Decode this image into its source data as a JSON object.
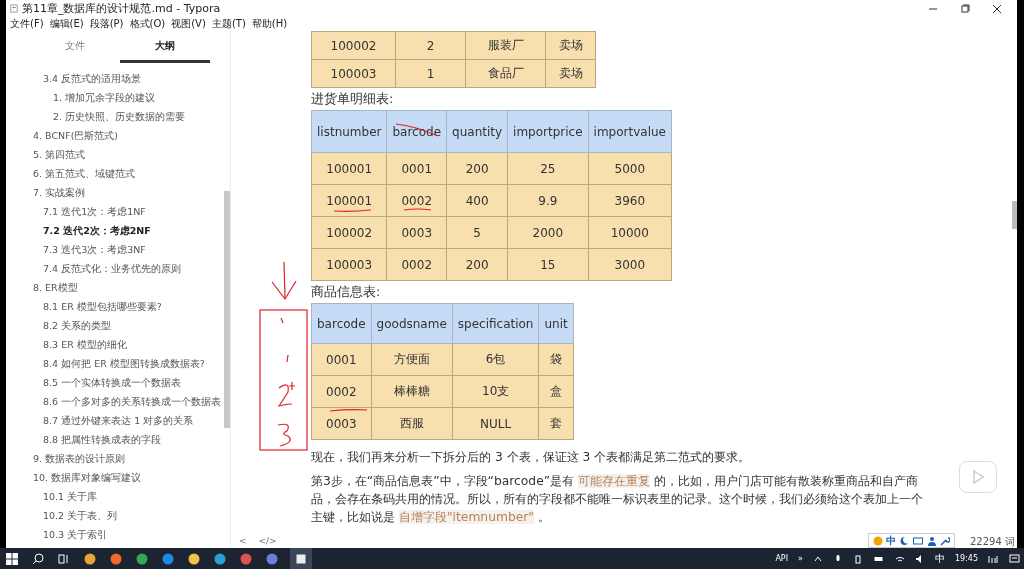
{
  "window": {
    "title": "第11章_数据库的设计规范.md - Typora"
  },
  "menu": [
    "文件(F)",
    "编辑(E)",
    "段落(P)",
    "格式(O)",
    "视图(V)",
    "主题(T)",
    "帮助(H)"
  ],
  "sidebar": {
    "tabs": [
      {
        "label": "文件",
        "selected": false
      },
      {
        "label": "大纲",
        "selected": true
      }
    ],
    "outline": [
      {
        "children": [
          {
            "label": "3.4 反范式的适用场景",
            "selected": false,
            "children": [
              {
                "label": "1. 增加冗余字段的建议",
                "selected": false
              },
              {
                "label": "2. 历史快照、历史数据的需要",
                "selected": false
              }
            ]
          }
        ]
      },
      {
        "label": "4. BCNF(巴斯范式)",
        "selected": false
      },
      {
        "label": "5. 第四范式",
        "selected": false
      },
      {
        "label": "6. 第五范式、域键范式",
        "selected": false
      },
      {
        "label": "7. 实战案例",
        "selected": false,
        "children": [
          {
            "label": "7.1 迭代1次：考虑1NF",
            "selected": false
          },
          {
            "label": "7.2 迭代2次：考虑2NF",
            "selected": true
          },
          {
            "label": "7.3 迭代3次：考虑3NF",
            "selected": false
          },
          {
            "label": "7.4 反范式化：业务优先的原则",
            "selected": false
          }
        ]
      },
      {
        "label": "8. ER模型",
        "selected": false,
        "children": [
          {
            "label": "8.1 ER 模型包括哪些要素?",
            "selected": false
          },
          {
            "label": "8.2 关系的类型",
            "selected": false
          },
          {
            "label": "8.3 ER 模型的细化",
            "selected": false
          },
          {
            "label": "8.4 如何把 ER 模型图转换成数据表?",
            "selected": false
          },
          {
            "label": "8.5 一个实体转换成一个数据表",
            "selected": false
          },
          {
            "label": "8.6 一个多对多的关系转换成一个数据表",
            "selected": false
          },
          {
            "label": "8.7 通过外键来表达 1 对多的关系",
            "selected": false
          },
          {
            "label": "8.8 把属性转换成表的字段",
            "selected": false
          }
        ]
      },
      {
        "label": "9. 数据表的设计原则",
        "selected": false
      },
      {
        "label": "10. 数据库对象编写建议",
        "selected": false,
        "children": [
          {
            "label": "10.1 关于库",
            "selected": false
          },
          {
            "label": "10.2 关于表、列",
            "selected": false
          },
          {
            "label": "10.3 关于索引",
            "selected": false
          }
        ]
      }
    ]
  },
  "document": [
    {
      "kind": "table",
      "rows": [
        [
          "100002",
          "2",
          "服装厂",
          "卖场"
        ],
        [
          "100003",
          "1",
          "食品厂",
          "卖场"
        ]
      ]
    },
    {
      "kind": "caption",
      "text": "进货单明细表:"
    },
    {
      "kind": "table",
      "columns": [
        "listnumber",
        "barcode",
        "quantity",
        "importprice",
        "importvalue"
      ],
      "rows": [
        [
          "100001",
          "0001",
          "200",
          "25",
          "5000"
        ],
        [
          "100001",
          "0002",
          "400",
          "9.9",
          "3960"
        ],
        [
          "100002",
          "0003",
          "5",
          "2000",
          "10000"
        ],
        [
          "100003",
          "0002",
          "200",
          "15",
          "3000"
        ]
      ]
    },
    {
      "kind": "caption",
      "text": "商品信息表:"
    },
    {
      "kind": "table",
      "columns": [
        "barcode",
        "goodsname",
        "specification",
        "unit"
      ],
      "rows": [
        [
          "0001",
          "方便面",
          "6包",
          "袋"
        ],
        [
          "0002",
          "棒棒糖",
          "10支",
          "盒"
        ],
        [
          "0003",
          "西服",
          "NULL",
          "套"
        ]
      ]
    },
    {
      "kind": "paragraph",
      "segments": [
        {
          "kind": "plain",
          "text": "现在，我们再来分析一下拆分后的 3 个表，保证这 3 个表都满足第二范式的要求。"
        }
      ]
    },
    {
      "kind": "paragraph",
      "segments": [
        {
          "kind": "plain",
          "text": "第3步，在“商品信息表”中，字段“barcode”是有 "
        },
        {
          "kind": "mark",
          "text": "可能存在重复"
        },
        {
          "kind": "plain",
          "text": " 的，比如，用户门店可能有散装称重商品和自产商品，会存在条码共用的情况。所以，所有的字段都不能唯一标识表里的记录。这个时候，我们必须给这个表加上一个主键，比如说是 "
        },
        {
          "kind": "mark",
          "text": "自增字段\"itemnumber\""
        },
        {
          "kind": "plain",
          "text": " 。"
        }
      ]
    }
  ],
  "editor_footer": [
    "<",
    "</>"
  ],
  "ime_toolbar": {
    "mode": "中"
  },
  "word_count": "22294 词",
  "tray": {
    "label": "API",
    "overflow": "»",
    "input": "中",
    "time": "19:45"
  }
}
